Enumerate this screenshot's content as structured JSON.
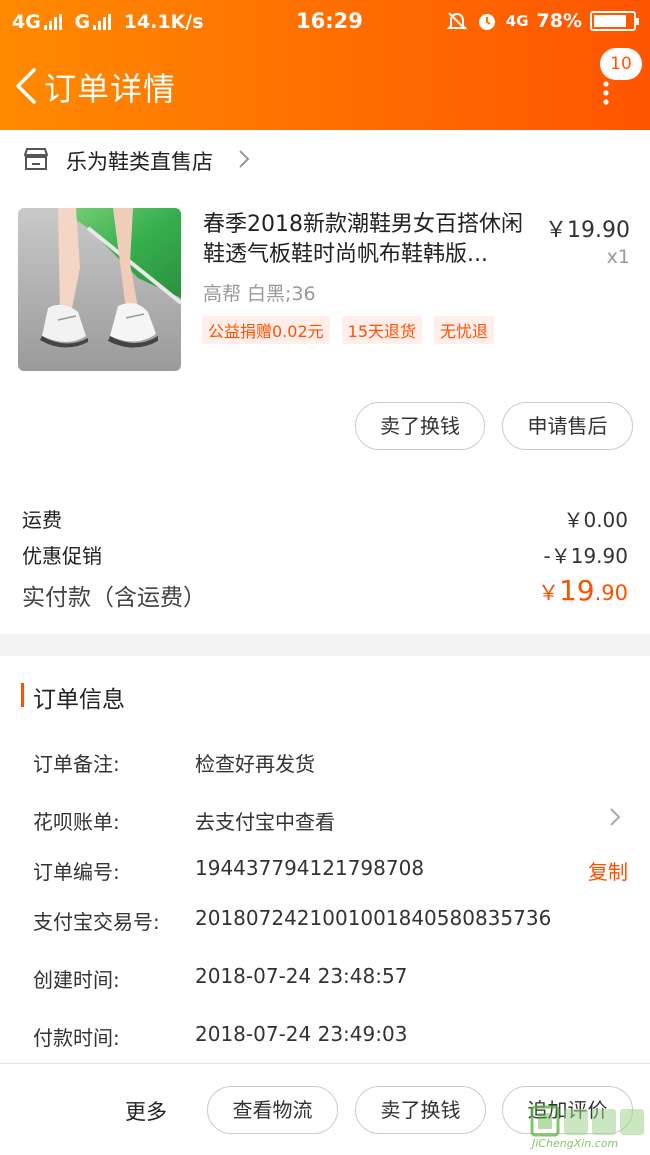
{
  "status_bar": {
    "network1": "4G",
    "network2": "G",
    "speed": "14.1K/s",
    "time": "16:29",
    "network3": "4G",
    "battery": "78%"
  },
  "header": {
    "title": "订单详情",
    "message_count": "10"
  },
  "shop": {
    "name": "乐为鞋类直售店"
  },
  "product": {
    "title": "春季2018新款潮鞋男女百搭休闲鞋透气板鞋时尚帆布鞋韩版...",
    "price": "￥19.90",
    "quantity": "x1",
    "spec": "高帮 白黑;36",
    "tags": [
      "公益捐赠0.02元",
      "15天退货",
      "无忧退"
    ]
  },
  "actions": {
    "sell_label": "卖了换钱",
    "after_sale_label": "申请售后"
  },
  "costs": {
    "shipping_label": "运费",
    "shipping_value": "￥0.00",
    "discount_label": "优惠促销",
    "discount_value": "-￥19.90",
    "paid_label": "实付款（含运费）",
    "paid_currency": "￥",
    "paid_integer": "19",
    "paid_decimal": ".90"
  },
  "order_info": {
    "section_title": "订单信息",
    "remark_label": "订单备注:",
    "remark_value": "检查好再发货",
    "huabei_label": "花呗账单:",
    "huabei_value": "去支付宝中查看",
    "order_no_label": "订单编号:",
    "order_no_value": "194437794121798708",
    "copy_label": "复制",
    "alipay_label": "支付宝交易号:",
    "alipay_value": "2018072421001001840580835736",
    "created_label": "创建时间:",
    "created_value": "2018-07-24 23:48:57",
    "paid_time_label": "付款时间:",
    "paid_time_value": "2018-07-24 23:49:03"
  },
  "bottom_bar": {
    "more_label": "更多",
    "logistics_label": "查看物流",
    "sell_label": "卖了换钱",
    "review_label": "追加评价"
  },
  "watermark": {
    "text": "JiChengXin.com"
  },
  "colors": {
    "accent": "#ff5000",
    "header_start": "#ff8a00",
    "header_end": "#ff5500",
    "tag_bg": "#ffeeea"
  }
}
